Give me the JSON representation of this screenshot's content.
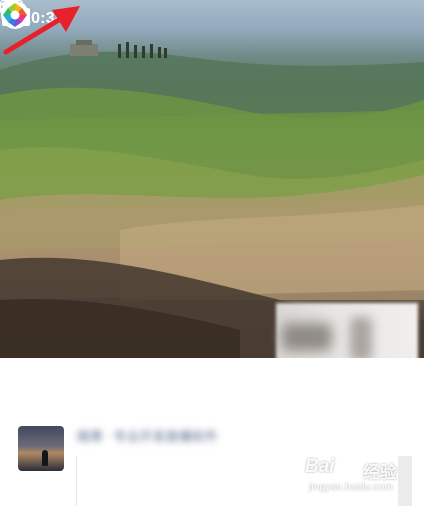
{
  "status_bar": {
    "time": "10:34",
    "location_icon": "location-arrow-icon",
    "signal_icon": "cellular-signal-icon",
    "wifi_icon": "wifi-icon",
    "battery_icon": "battery-icon"
  },
  "header": {
    "back_icon": "chevron-left-icon",
    "camera_icon": "camera-icon",
    "app_logo_icon": "aperture-logo-icon",
    "annotation_icon": "red-arrow-icon",
    "annotation_color": "#e8202a"
  },
  "post": {
    "author_blurred": "湘潭 · 专业开发直播软件",
    "avatar_icon": "sunset-silhouette-avatar"
  },
  "watermark": {
    "brand_left": "Bai",
    "brand_right": "经验",
    "url": "jingyan.baidu.com"
  },
  "colors": {
    "link_name": "#5a6b8f",
    "background": "#ffffff"
  }
}
